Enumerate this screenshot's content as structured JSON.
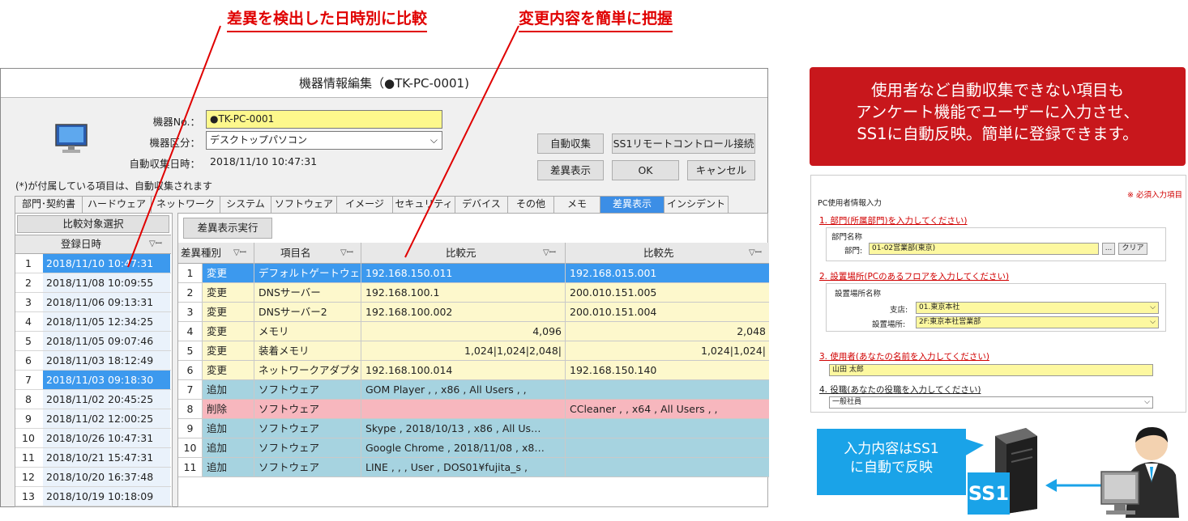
{
  "callouts": {
    "left": "差異を検出した日時別に比較",
    "right": "変更内容を簡単に把握"
  },
  "window": {
    "title": "機器情報編集（●TK-PC-0001)",
    "labels": {
      "device_no": "機器No.：",
      "device_type": "機器区分：",
      "auto_collect_time": "自動収集日時："
    },
    "device_no_value": "●TK-PC-0001",
    "device_type_value": "デスクトップパソコン",
    "auto_collect_time_value": "2018/11/10 10:47:31",
    "note": "(*)が付属している項目は、自動収集されます",
    "buttons": {
      "auto_collect": "自動収集",
      "remote": "SS1リモートコントロール接続",
      "diff_show": "差異表示",
      "ok": "OK",
      "cancel": "キャンセル",
      "run_diff": "差異表示実行"
    },
    "tabs": [
      "部門･契約書",
      "ハードウェア",
      "ネットワーク",
      "システム",
      "ソフトウェア",
      "イメージ",
      "セキュリティ",
      "デバイス",
      "その他",
      "メモ",
      "差異表示",
      "インシデント"
    ],
    "active_tab": "差異表示",
    "left_panel": {
      "header": "比較対象選択",
      "column": "登録日時",
      "rows": [
        {
          "no": "1",
          "date": "2018/11/10 10:47:31",
          "selected": true
        },
        {
          "no": "2",
          "date": "2018/11/08 10:09:55"
        },
        {
          "no": "3",
          "date": "2018/11/06 09:13:31"
        },
        {
          "no": "4",
          "date": "2018/11/05 12:34:25"
        },
        {
          "no": "5",
          "date": "2018/11/05 09:07:46"
        },
        {
          "no": "6",
          "date": "2018/11/03 18:12:49"
        },
        {
          "no": "7",
          "date": "2018/11/03 09:18:30",
          "selected": true
        },
        {
          "no": "8",
          "date": "2018/11/02 20:45:25"
        },
        {
          "no": "9",
          "date": "2018/11/02 12:00:25"
        },
        {
          "no": "10",
          "date": "2018/10/26 10:47:31"
        },
        {
          "no": "11",
          "date": "2018/10/21 15:47:31"
        },
        {
          "no": "12",
          "date": "2018/10/20 16:37:48"
        },
        {
          "no": "13",
          "date": "2018/10/19 10:18:09"
        }
      ]
    },
    "diff_table": {
      "columns": [
        "差異種別",
        "項目名",
        "比較元",
        "比較先"
      ],
      "rows": [
        [
          "1",
          "変更",
          "デフォルトゲートウェイ",
          "192.168.150.011",
          "192.168.015.001"
        ],
        [
          "2",
          "変更",
          "DNSサーバー",
          "192.168.100.1",
          "200.010.151.005"
        ],
        [
          "3",
          "変更",
          "DNSサーバー2",
          "192.168.100.002",
          "200.010.151.004"
        ],
        [
          "4",
          "変更",
          "メモリ",
          "4,096",
          "2,048"
        ],
        [
          "5",
          "変更",
          "装着メモリ",
          "1,024|1,024|2,048|",
          "1,024|1,024|"
        ],
        [
          "6",
          "変更",
          "ネットワークアダプタ(…",
          "192.168.100.014",
          "192.168.150.140"
        ],
        [
          "7",
          "追加",
          "ソフトウェア",
          "GOM Player , , x86 , All Users , ,",
          ""
        ],
        [
          "8",
          "削除",
          "ソフトウェア",
          "",
          "CCleaner , , x64 , All Users , ,"
        ],
        [
          "9",
          "追加",
          "ソフトウェア",
          "Skype , 2018/10/13 , x86 , All Us…",
          ""
        ],
        [
          "10",
          "追加",
          "ソフトウェア",
          "Google Chrome , 2018/11/08 , x8…",
          ""
        ],
        [
          "11",
          "追加",
          "ソフトウェア",
          "LINE , , , User , DOS01¥fujita_s ,",
          ""
        ]
      ]
    }
  },
  "promo": {
    "line1": "使用者など自動収集できない項目も",
    "line2": "アンケート機能でユーザーに入力させ、",
    "line3": "SS1に自動反映。簡単に登録できます。"
  },
  "form": {
    "title": "PC使用者情報入力",
    "required_note": "※ 必須入力項目",
    "s1": "1. 部門(所属部門)を入力してください)",
    "s1_group": "部門名称",
    "s1_label": "部門:",
    "s1_value": "01-02営業部(東京)",
    "s1_btn_dots": "...",
    "s1_btn_clear": "クリア",
    "s2": "2. 設置場所(PCのあるフロアを入力してください)",
    "s2_group": "設置場所名称",
    "s2_label_a": "支店:",
    "s2_value_a": "01.東京本社",
    "s2_label_b": "設置場所:",
    "s2_value_b": "2F:東京本社営業部",
    "s3": "3. 使用者(あなたの名前を入力してください)",
    "s3_value": "山田 太郎",
    "s4": "4. 役職(あなたの役職を入力してください)",
    "s4_value": "一般社員"
  },
  "bubble": {
    "line1": "入力内容はSS1",
    "line2": "に自動で反映"
  },
  "logo_text": "SS1"
}
